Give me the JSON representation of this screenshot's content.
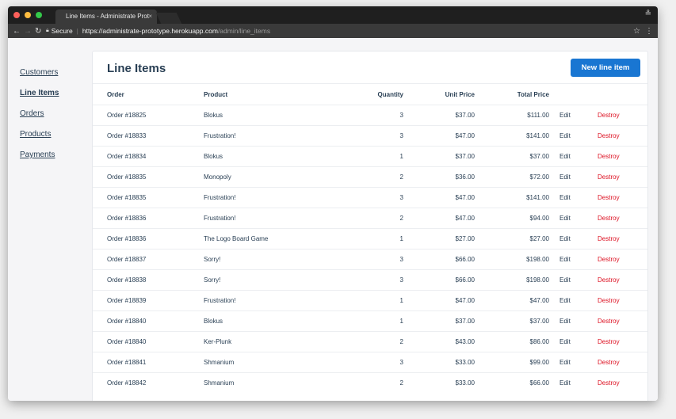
{
  "browser": {
    "tab_title": "Line Items - Administrate Prot",
    "tab_close": "×",
    "secure_label": "Secure",
    "url_host": "https://administrate-prototype.herokuapp.com",
    "url_path": "/admin/line_items"
  },
  "sidebar": {
    "items": [
      {
        "label": "Customers",
        "active": false
      },
      {
        "label": "Line Items",
        "active": true
      },
      {
        "label": "Orders",
        "active": false
      },
      {
        "label": "Products",
        "active": false
      },
      {
        "label": "Payments",
        "active": false
      }
    ]
  },
  "page": {
    "title": "Line Items",
    "new_button": "New line item"
  },
  "table": {
    "headers": {
      "order": "Order",
      "product": "Product",
      "quantity": "Quantity",
      "unit_price": "Unit Price",
      "total_price": "Total Price"
    },
    "edit_label": "Edit",
    "destroy_label": "Destroy",
    "rows": [
      {
        "order": "Order #18825",
        "product": "Blokus",
        "quantity": "3",
        "unit_price": "$37.00",
        "total_price": "$111.00"
      },
      {
        "order": "Order #18833",
        "product": "Frustration!",
        "quantity": "3",
        "unit_price": "$47.00",
        "total_price": "$141.00"
      },
      {
        "order": "Order #18834",
        "product": "Blokus",
        "quantity": "1",
        "unit_price": "$37.00",
        "total_price": "$37.00"
      },
      {
        "order": "Order #18835",
        "product": "Monopoly",
        "quantity": "2",
        "unit_price": "$36.00",
        "total_price": "$72.00"
      },
      {
        "order": "Order #18835",
        "product": "Frustration!",
        "quantity": "3",
        "unit_price": "$47.00",
        "total_price": "$141.00"
      },
      {
        "order": "Order #18836",
        "product": "Frustration!",
        "quantity": "2",
        "unit_price": "$47.00",
        "total_price": "$94.00"
      },
      {
        "order": "Order #18836",
        "product": "The Logo Board Game",
        "quantity": "1",
        "unit_price": "$27.00",
        "total_price": "$27.00"
      },
      {
        "order": "Order #18837",
        "product": "Sorry!",
        "quantity": "3",
        "unit_price": "$66.00",
        "total_price": "$198.00"
      },
      {
        "order": "Order #18838",
        "product": "Sorry!",
        "quantity": "3",
        "unit_price": "$66.00",
        "total_price": "$198.00"
      },
      {
        "order": "Order #18839",
        "product": "Frustration!",
        "quantity": "1",
        "unit_price": "$47.00",
        "total_price": "$47.00"
      },
      {
        "order": "Order #18840",
        "product": "Blokus",
        "quantity": "1",
        "unit_price": "$37.00",
        "total_price": "$37.00"
      },
      {
        "order": "Order #18840",
        "product": "Ker-Plunk",
        "quantity": "2",
        "unit_price": "$43.00",
        "total_price": "$86.00"
      },
      {
        "order": "Order #18841",
        "product": "Shmanium",
        "quantity": "3",
        "unit_price": "$33.00",
        "total_price": "$99.00"
      },
      {
        "order": "Order #18842",
        "product": "Shmanium",
        "quantity": "2",
        "unit_price": "$33.00",
        "total_price": "$66.00"
      }
    ]
  },
  "colors": {
    "accent": "#1976d2",
    "destroy": "#dd1122",
    "text": "#293f54"
  }
}
